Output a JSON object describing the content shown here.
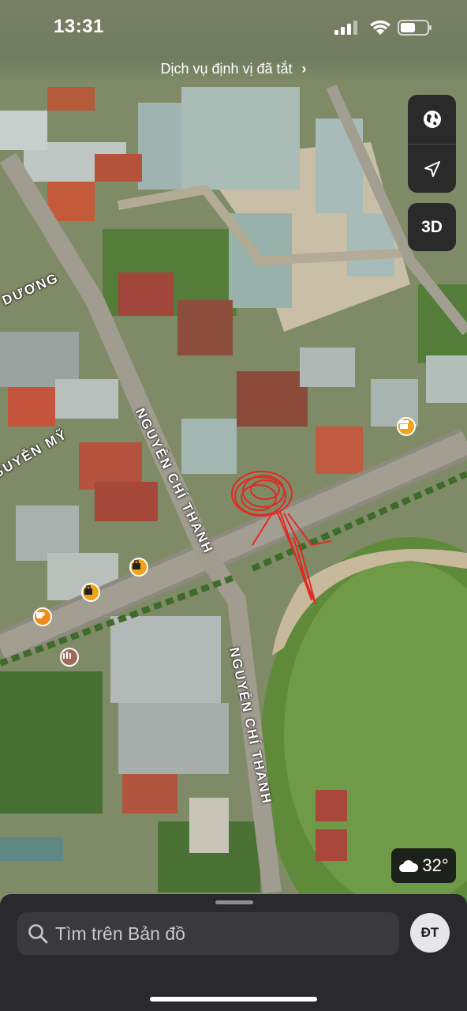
{
  "status_bar": {
    "time": "13:31",
    "icons": [
      "signal-icon",
      "wifi-icon",
      "battery-icon"
    ]
  },
  "location_banner": {
    "text": "Dịch vụ định vị đã tắt",
    "icon": "chevron-right-icon"
  },
  "map_controls": {
    "map_mode_icon": "globe-icon",
    "location_icon": "location-arrow-icon",
    "three_d_label": "3D"
  },
  "road_labels": {
    "duong": "DƯƠNG",
    "nguyen_my": "GUYỄN MỸ",
    "nguyen_chi_thanh_1": "NGUYỄN CHÍ THANH",
    "nguyen_chi_thanh_2": "NGUYỄN CHÍ THANH"
  },
  "pois": [
    {
      "icon": "shop-icon",
      "color": "#f0a21a"
    },
    {
      "icon": "bag-icon",
      "color": "#f0a21a"
    },
    {
      "icon": "bag-icon",
      "color": "#f0a21a"
    },
    {
      "icon": "cafe-icon",
      "color": "#f08a1a"
    },
    {
      "icon": "landmark-icon",
      "color": "#a06a5a"
    }
  ],
  "weather": {
    "icon": "cloud-icon",
    "temperature": "32°"
  },
  "bottom_sheet": {
    "search_placeholder": "Tìm trên Bản đồ",
    "avatar_initials": "ĐT"
  }
}
